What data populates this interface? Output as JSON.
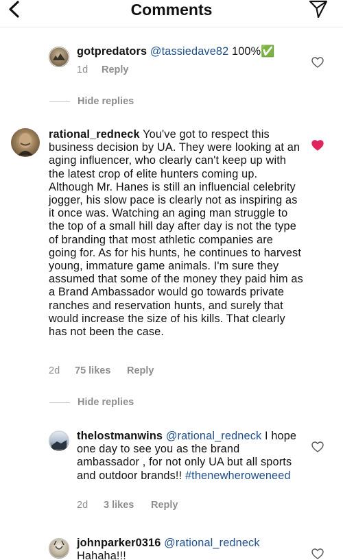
{
  "header": {
    "title": "Comments",
    "back_icon": "chevron-left-icon",
    "share_icon": "paper-plane-icon"
  },
  "colors": {
    "liked_heart": "#e0245e",
    "link": "#1f4f8b",
    "meta_text": "#8e8e8e"
  },
  "comments": [
    {
      "username": "gotpredators",
      "mention": "@tassiedave82",
      "body": " 100%✅",
      "time": "1d",
      "likes": "",
      "reply_label": "Reply",
      "liked": false
    },
    {
      "username": "rational_redneck",
      "mention": "",
      "body": " You've got to respect this business decision by UA. They were looking at an aging influencer, who clearly can't keep up with the latest crop of elite hunters coming up. Although Mr. Hanes is still an influencial celebrity jogger, his slow pace is clearly not as inspiring as it once was. Watching an aging man struggle to the top of a small hill day after day is not the type of branding that most athletic companies are going for. As for his hunts, he continues to harvest young, immature game animals. I'm sure they assumed that some of the money they paid him as a Brand Ambassador would go towards private ranches and reservation hunts, and surely that would increase the size of his kills. That clearly has not been the case.",
      "time": "2d",
      "likes": "75 likes",
      "reply_label": "Reply",
      "liked": true
    },
    {
      "username": "thelostmanwins",
      "mention": "@rational_redneck",
      "body": " I hope one day to see you as the brand ambassador , for not only UA but all sports and outdoor brands!! ",
      "hashtag": "#thenewheroweneed",
      "time": "2d",
      "likes": "3 likes",
      "reply_label": "Reply",
      "liked": false
    },
    {
      "username": "johnparker0316",
      "mention": "@rational_redneck",
      "body": " Hahaha!!!",
      "liked": false
    }
  ],
  "hide_replies_label": "Hide replies"
}
